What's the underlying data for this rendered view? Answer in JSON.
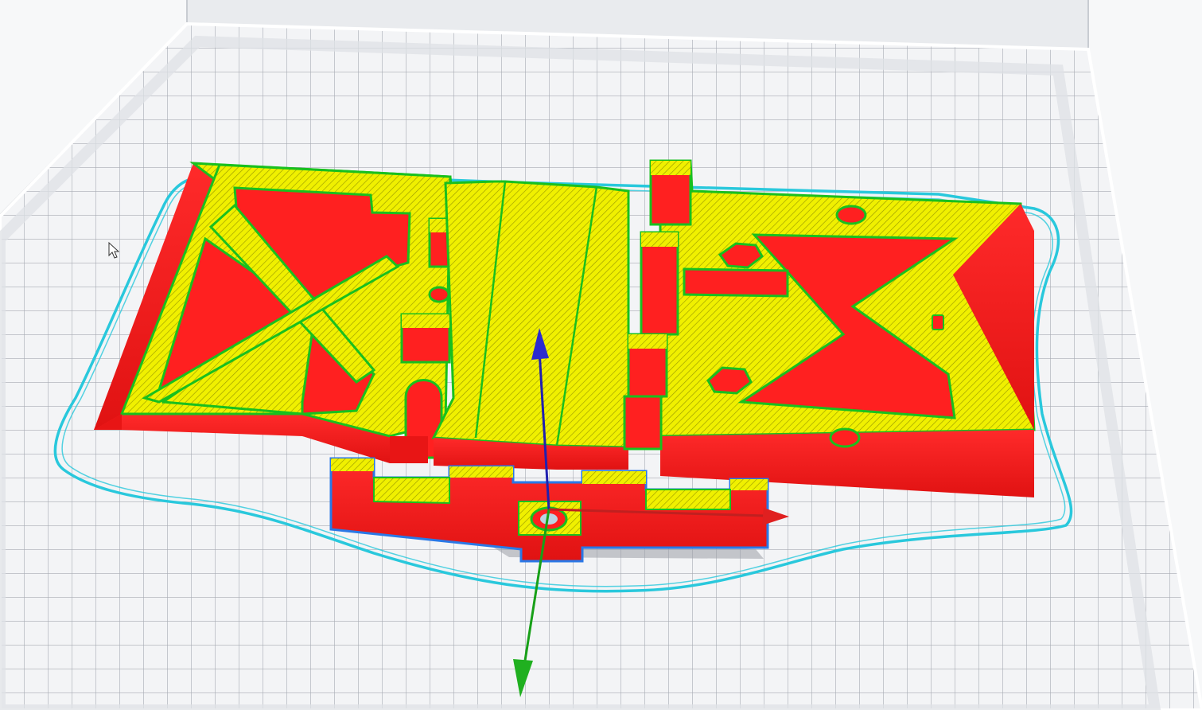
{
  "viewport": {
    "mode": "layer-preview",
    "colors": {
      "background": "#e9ebee",
      "plate": "#f3f4f6",
      "grid": "#a7abb3",
      "plate_edge": "#ffffff",
      "wall_outer": "#ff1f1f",
      "wall_inner": "#19c01e",
      "infill": "#f0f000",
      "skirt": "#29c8dc",
      "axis_x": "#e02020",
      "axis_y": "#20b020",
      "axis_z": "#2020c0"
    },
    "icons": {
      "cursor": "mouse-pointer-icon"
    }
  }
}
